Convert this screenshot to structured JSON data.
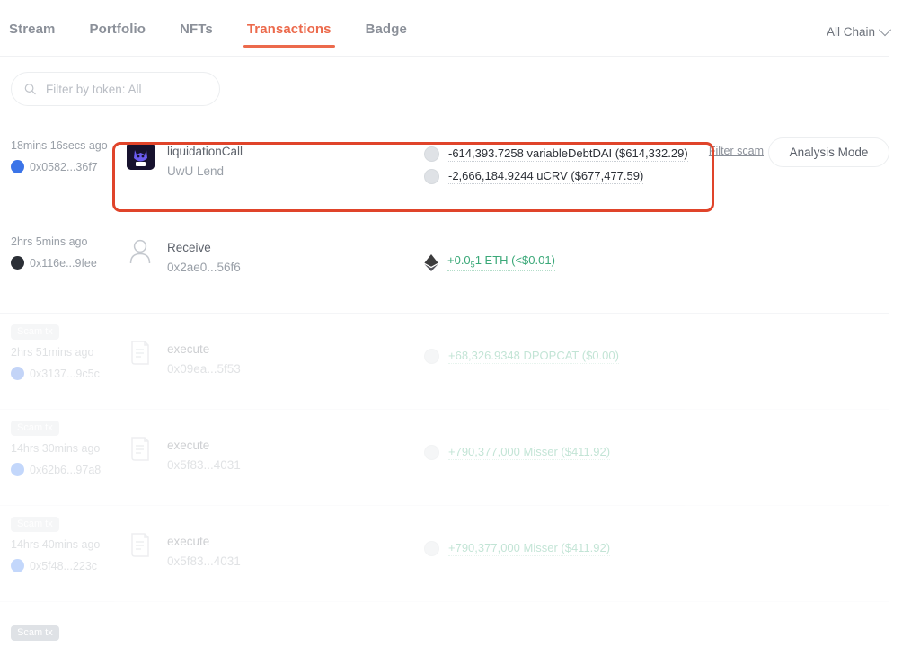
{
  "nav": {
    "tabs": [
      {
        "label": "Stream",
        "active": false
      },
      {
        "label": "Portfolio",
        "active": false
      },
      {
        "label": "NFTs",
        "active": false
      },
      {
        "label": "Transactions",
        "active": true
      },
      {
        "label": "Badge",
        "active": false
      }
    ],
    "chain_filter": "All Chain",
    "accent_color": "#ec6a4c"
  },
  "toolbar": {
    "search_placeholder": "Filter by token: All",
    "search_value": "",
    "filter_scam_label": "Filter scam",
    "analysis_mode_label": "Analysis Mode"
  },
  "highlight": {
    "color": "#e0442a"
  },
  "transactions": [
    {
      "time": "18mins 16secs ago",
      "hash": "0x0582...36f7",
      "chain_icon": "ethereum-chain-icon",
      "scam": false,
      "action": "liquidationCall",
      "sub": "UwU Lend",
      "icon": "uwu-lend-logo",
      "assets": [
        {
          "text": "-614,393.7258 variableDebtDAI ($614,332.29)",
          "sign": "neg"
        },
        {
          "text": "-2,666,184.9244 uCRV ($677,477.59)",
          "sign": "neg"
        }
      ]
    },
    {
      "time": "2hrs 5mins ago",
      "hash": "0x116e...9fee",
      "chain_icon": "ethereum-chain-icon",
      "scam": false,
      "action": "Receive",
      "sub": "0x2ae0...56f6",
      "icon": "person-icon",
      "assets": [
        {
          "text_prefix": "+0.0",
          "subscript": "5",
          "text_suffix": "1 ETH (<$0.01)",
          "sign": "pos",
          "token_icon": "eth-token-icon"
        }
      ]
    },
    {
      "time": "2hrs 51mins ago",
      "hash": "0x3137...9c5c",
      "chain_icon": "blue-chain-icon",
      "scam": true,
      "scam_label": "Scam tx",
      "action": "execute",
      "sub": "0x09ea...5f53",
      "icon": "contract-icon",
      "assets": [
        {
          "text": "+68,326.9348 DPOPCAT ($0.00)",
          "sign": "pos"
        }
      ]
    },
    {
      "time": "14hrs 30mins ago",
      "hash": "0x62b6...97a8",
      "chain_icon": "base-chain-icon",
      "scam": true,
      "scam_label": "Scam tx",
      "action": "execute",
      "sub": "0x5f83...4031",
      "icon": "contract-icon",
      "assets": [
        {
          "text": "+790,377,000 Misser ($411.92)",
          "sign": "pos"
        }
      ]
    },
    {
      "time": "14hrs 40mins ago",
      "hash": "0x5f48...223c",
      "chain_icon": "base-chain-icon",
      "scam": true,
      "scam_label": "Scam tx",
      "action": "execute",
      "sub": "0x5f83...4031",
      "icon": "contract-icon",
      "assets": [
        {
          "text": "+790,377,000 Misser ($411.92)",
          "sign": "pos"
        }
      ]
    }
  ],
  "partial_row": {
    "scam_label": "Scam tx"
  }
}
